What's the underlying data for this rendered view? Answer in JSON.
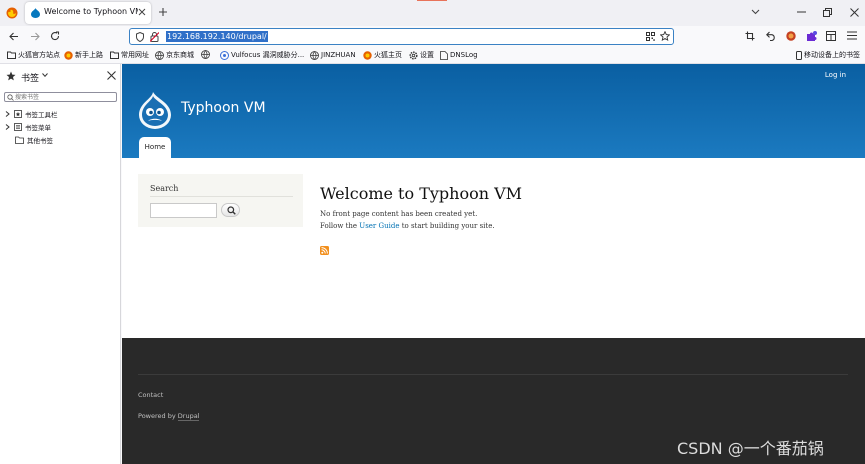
{
  "tab": {
    "title": "Welcome to Typhoon VM | Ty"
  },
  "urlbar": {
    "url": "192.168.192.140/drupal/"
  },
  "bookmarks": [
    {
      "label": "火狐官方站点",
      "icon": "folder-icon"
    },
    {
      "label": "新手上路",
      "icon": "firefox-icon"
    },
    {
      "label": "常用网址",
      "icon": "folder-icon"
    },
    {
      "label": "京东商城",
      "icon": "globe-icon"
    },
    {
      "label": "",
      "icon": "globe-icon"
    },
    {
      "label": "Vulfocus 漏洞威胁分...",
      "icon": "vulfocus-icon"
    },
    {
      "label": "JINZHUAN",
      "icon": "globe-icon"
    },
    {
      "label": "火狐主页",
      "icon": "firefox-icon"
    },
    {
      "label": "设置",
      "icon": "gear-icon"
    },
    {
      "label": "DNSLog",
      "icon": "document-icon"
    }
  ],
  "mobile_bookmarks": "移动设备上的书签",
  "sidebar": {
    "title": "书签",
    "search_placeholder": "搜索书签",
    "tree": [
      {
        "label": "书签工具栏",
        "expandable": true
      },
      {
        "label": "书签菜单",
        "expandable": true
      },
      {
        "label": "其他书签",
        "expandable": false
      }
    ]
  },
  "page": {
    "login": "Log in",
    "site_name": "Typhoon VM",
    "home_tab": "Home",
    "search_heading": "Search",
    "title": "Welcome to Typhoon VM",
    "no_content": "No front page content has been created yet.",
    "follow_prefix": "Follow the",
    "user_guide": "User Guide",
    "follow_suffix": "to start building your site.",
    "footer_contact": "Contact",
    "powered_prefix": "Powered by",
    "powered_link": "Drupal"
  },
  "watermark": "CSDN @一个番茄锅",
  "colors": {
    "header": "#0a5fa2",
    "footer": "#292929",
    "url_highlight": "#3070c8",
    "link": "#0071b3"
  }
}
